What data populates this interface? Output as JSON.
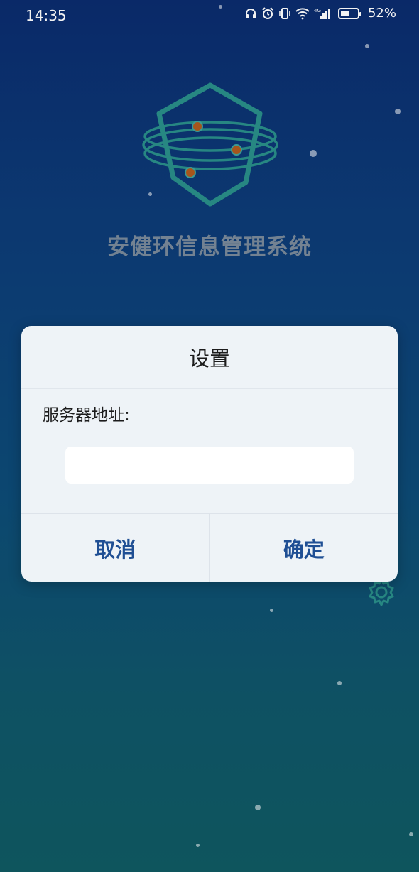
{
  "status_bar": {
    "time": "14:35",
    "network": "4G",
    "battery_percent_text": "52%",
    "battery_level": 0.52
  },
  "app": {
    "title": "安健环信息管理系统"
  },
  "dialog": {
    "title": "设置",
    "server_label": "服务器地址:",
    "server_value": "",
    "cancel_label": "取消",
    "confirm_label": "确定"
  },
  "colors": {
    "accent": "#1f4f94",
    "logo": "#2a8f8a",
    "logo_dots": "#b05a1e"
  }
}
